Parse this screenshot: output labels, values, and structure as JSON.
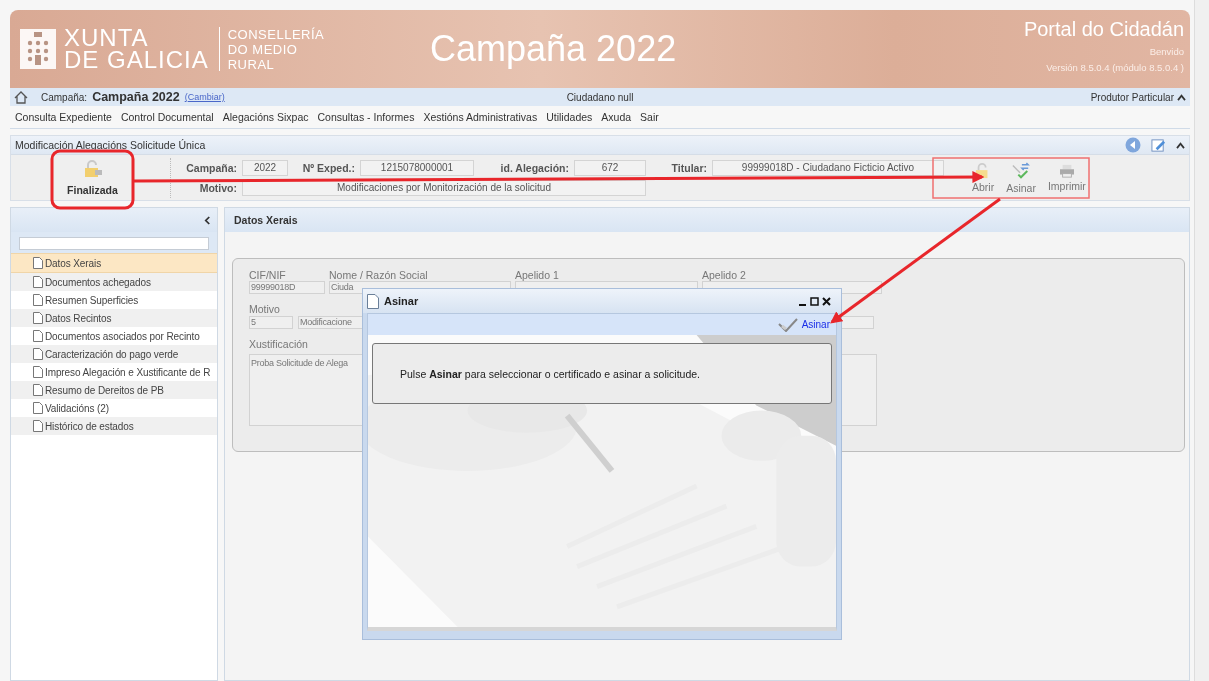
{
  "header": {
    "org_lines": [
      "XUNTA",
      "DE GALICIA"
    ],
    "department_lines": [
      "CONSELLERÍA",
      "DO MEDIO",
      "RURAL"
    ],
    "title": "Campaña 2022",
    "portal": "Portal do Cidadán",
    "greeting": "Benvido",
    "version": "Versión 8.5.0.4 (módulo 8.5.0.4 )"
  },
  "info_bar": {
    "campaign_label": "Campaña:",
    "campaign": "Campaña 2022",
    "change_link": "(Cambiar)",
    "user": "Ciudadano null",
    "profile": "Produtor Particular"
  },
  "menu": [
    "Consulta Expediente",
    "Control Documental",
    "Alegacións Sixpac",
    "Consultas - Informes",
    "Xestións Administrativas",
    "Utilidades",
    "Axuda",
    "Sair"
  ],
  "panel": {
    "title": "Modificación Alegacións Solicitude Única",
    "status": "Finalizada",
    "fields": [
      {
        "label": "Campaña:",
        "value": "2022"
      },
      {
        "label": "Nº Exped.:",
        "value": "1215078000001"
      },
      {
        "label": "id. Alegación:",
        "value": "672"
      },
      {
        "label": "Titular:",
        "value": "99999018D - Ciudadano Ficticio Activo"
      }
    ],
    "reason": {
      "label": "Motivo:",
      "value": "Modificaciones por Monitorización de la solicitud"
    },
    "actions": [
      {
        "label": "Abrir",
        "kind": "unlock"
      },
      {
        "label": "Asinar",
        "kind": "sign"
      },
      {
        "label": "Imprimir",
        "kind": "print"
      }
    ]
  },
  "sidebar": {
    "items": [
      {
        "label": "Datos Xerais",
        "selected": true
      },
      {
        "label": "Documentos achegados",
        "selected": false
      },
      {
        "label": "Resumen Superficies",
        "selected": false
      },
      {
        "label": "Datos Recintos",
        "selected": false
      },
      {
        "label": "Documentos asociados por Recinto",
        "selected": false
      },
      {
        "label": "Caracterización do pago verde",
        "selected": false
      },
      {
        "label": "Impreso Alegación e Xustificante de R",
        "selected": false
      },
      {
        "label": "Resumo de Dereitos de PB",
        "selected": false
      },
      {
        "label": "Validacións (2)",
        "selected": false
      },
      {
        "label": "Histórico de estados",
        "selected": false
      }
    ]
  },
  "content": {
    "title": "Datos Xerais",
    "labels": [
      "CIF/NIF",
      "Nome / Razón Social",
      "Apelido 1",
      "Apelido 2"
    ],
    "tax_id": "99999018D",
    "name": "Ciuda",
    "reason_label": "Motivo",
    "reason_code": "5",
    "reason_text": "Modificacione",
    "justification_label": "Xustificación",
    "justification": "Proba Solicitude de Alega"
  },
  "dialog": {
    "title": "Asinar",
    "action": "Asinar",
    "message": "Pulse **Asinar** para seleccionar o certificado e asinar a solicitude."
  }
}
